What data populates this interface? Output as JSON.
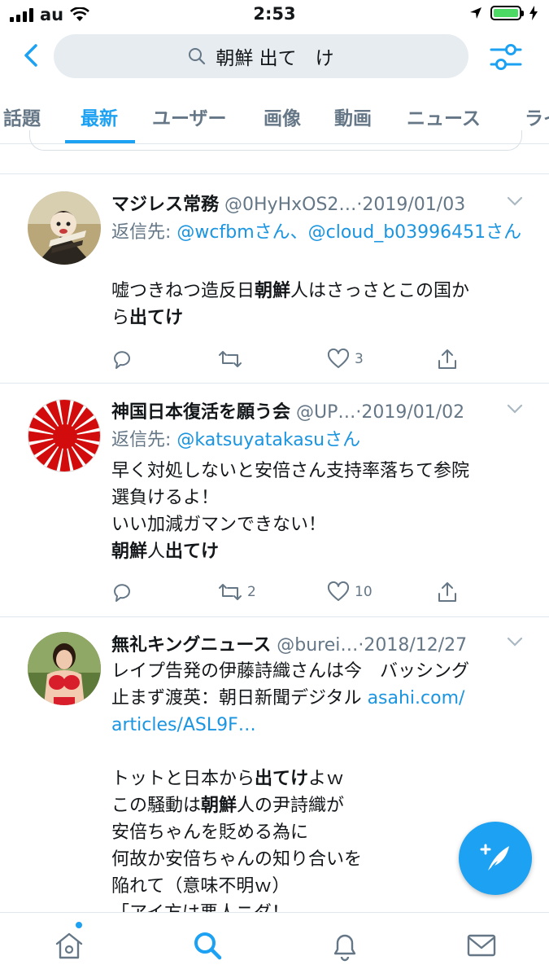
{
  "status": {
    "carrier": "au",
    "time": "2:53"
  },
  "search": {
    "query": "朝鮮 出て　け"
  },
  "tabs": [
    {
      "label": "話題"
    },
    {
      "label": "最新"
    },
    {
      "label": "ユーザー"
    },
    {
      "label": "画像"
    },
    {
      "label": "動画"
    },
    {
      "label": "ニュース"
    },
    {
      "label": "ライ"
    }
  ],
  "tweets": [
    {
      "name": "マジレス常務",
      "handle_date": "@0HyHxOS2…·2019/01/03",
      "reply_prefix": "返信先: ",
      "reply_to": "@wcfbmさん、@cloud_b03996451さん",
      "lines": [
        [
          "嘘つきねつ造反日",
          "朝鮮",
          "人はさっさとこの国か"
        ],
        [
          "ら",
          "出てけ",
          ""
        ]
      ],
      "likes": "3",
      "retweets": ""
    },
    {
      "name": "神国日本復活を願う会",
      "handle_date": "@UP…·2019/01/02",
      "reply_prefix": "返信先: ",
      "reply_to": "@katsuyatakasuさん",
      "lines": [
        [
          "早く対処しないと安倍さん支持率落ちて参院"
        ],
        [
          "選負けるよ！"
        ],
        [
          "いい加減ガマンできない！"
        ],
        [
          "",
          "朝鮮",
          "人",
          "出てけ"
        ]
      ],
      "retweets": "2",
      "likes": "10"
    },
    {
      "name": "無礼キングニュース",
      "handle_date": "@burei…·2018/12/27",
      "text1": "レイプ告発の伊藤詩織さんは今　バッシング",
      "text2": "止まず渡英：朝日新聞デジタル ",
      "link1": "asahi.com/",
      "link2": "articles/ASL9F…",
      "l4a": "トットと日本から",
      "l4b": "出てけ",
      "l4c": "よｗ",
      "l5a": "この騒動は",
      "l5b": "朝鮮",
      "l5c": "人の尹詩織が",
      "l6": "安倍ちゃんを貶める為に",
      "l7": "何故か安倍ちゃんの知り合いを",
      "l8": "陥れて（意味不明ｗ）",
      "l9": "「アイ方は悪人ニダ！"
    }
  ],
  "colors": {
    "accent": "#1da1f2",
    "secondary": "#657786",
    "battery": "#4cd964"
  }
}
